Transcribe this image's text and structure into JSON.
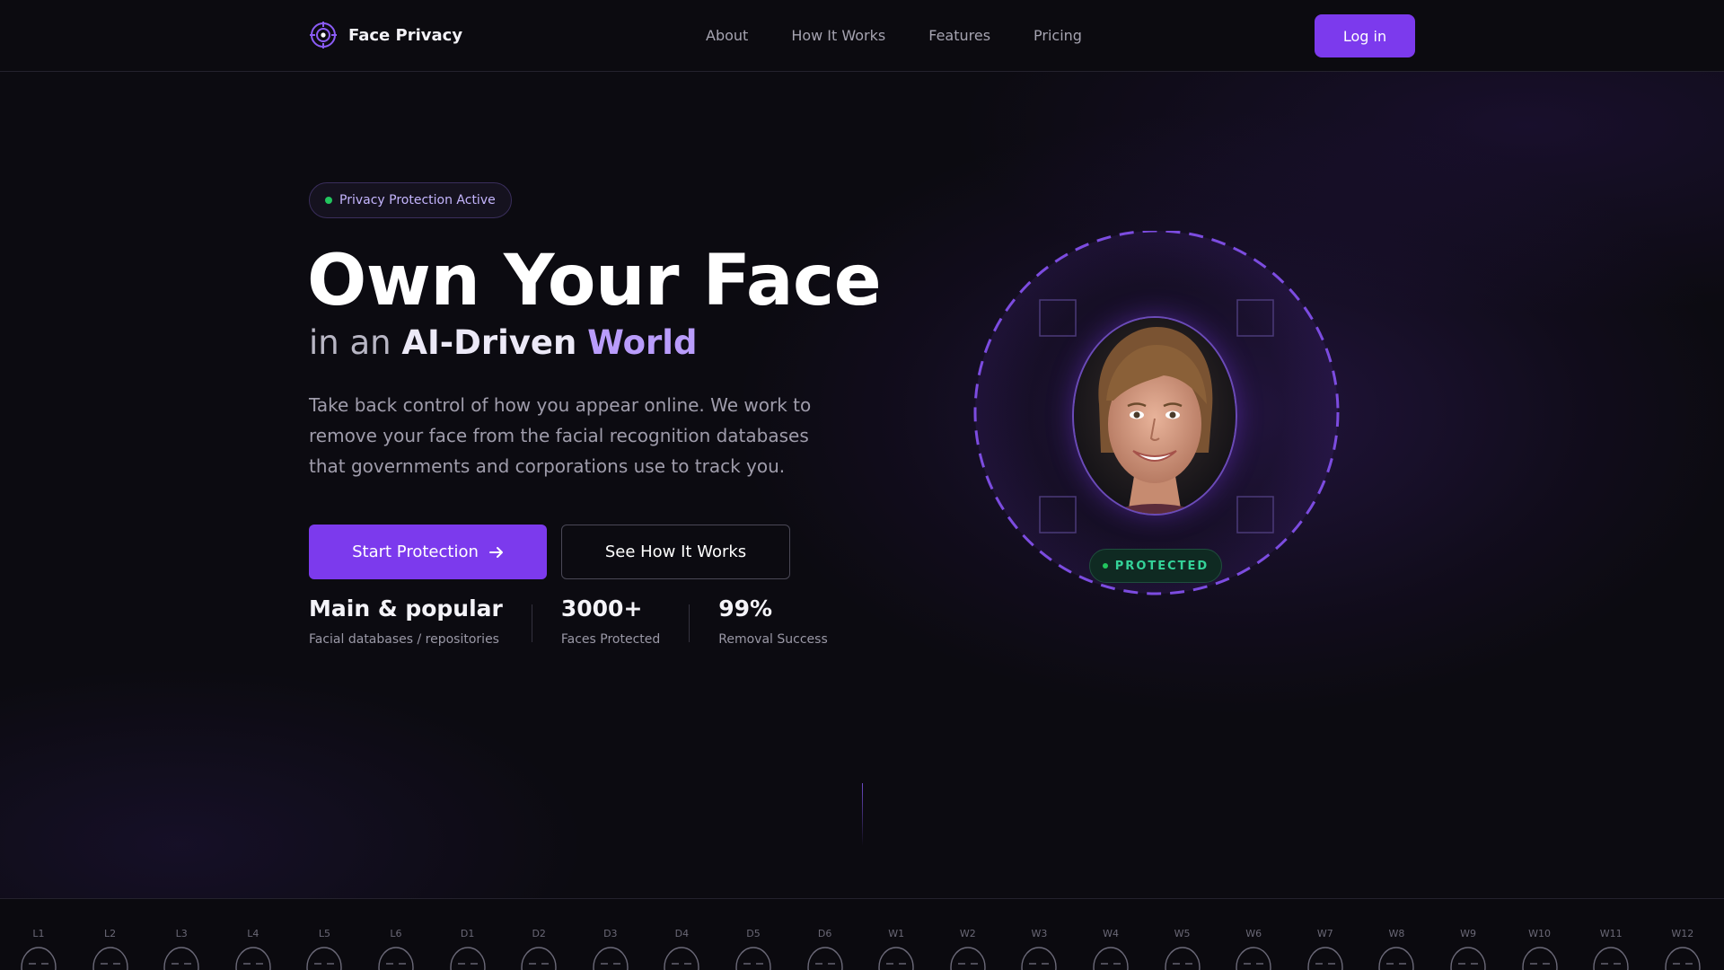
{
  "nav": {
    "brand": "Face Privacy",
    "links": [
      "About",
      "How It Works",
      "Features",
      "Pricing"
    ],
    "login": "Log in"
  },
  "hero": {
    "badge": "Privacy Protection Active",
    "title": "Own Your Face",
    "subtitle_prefix": "in an",
    "subtitle_strong": "AI-Driven",
    "subtitle_accent": "World",
    "description": "Take back control of how you appear online. We work to remove your face from the facial recognition databases that governments and corporations use to track you.",
    "primary_button": "Start Protection",
    "primary_icon": "arrow-right-icon",
    "secondary_button": "See How It Works"
  },
  "stats": [
    {
      "value": "Main & popular",
      "label": "Facial databases / repositories"
    },
    {
      "value": "3000+",
      "label": "Faces Protected"
    },
    {
      "value": "99%",
      "label": "Removal Success"
    }
  ],
  "scanner": {
    "status": "PROTECTED"
  },
  "strip": [
    "L1",
    "L2",
    "L3",
    "L4",
    "L5",
    "L6",
    "D1",
    "D2",
    "D3",
    "D4",
    "D5",
    "D6",
    "W1",
    "W2",
    "W3",
    "W4",
    "W5",
    "W6",
    "W7",
    "W8",
    "W9",
    "W10",
    "W11",
    "W12"
  ],
  "colors": {
    "accent": "#7c3aed",
    "accent_light": "#b99cfb",
    "success": "#22c55e",
    "background": "#0c0b11"
  }
}
